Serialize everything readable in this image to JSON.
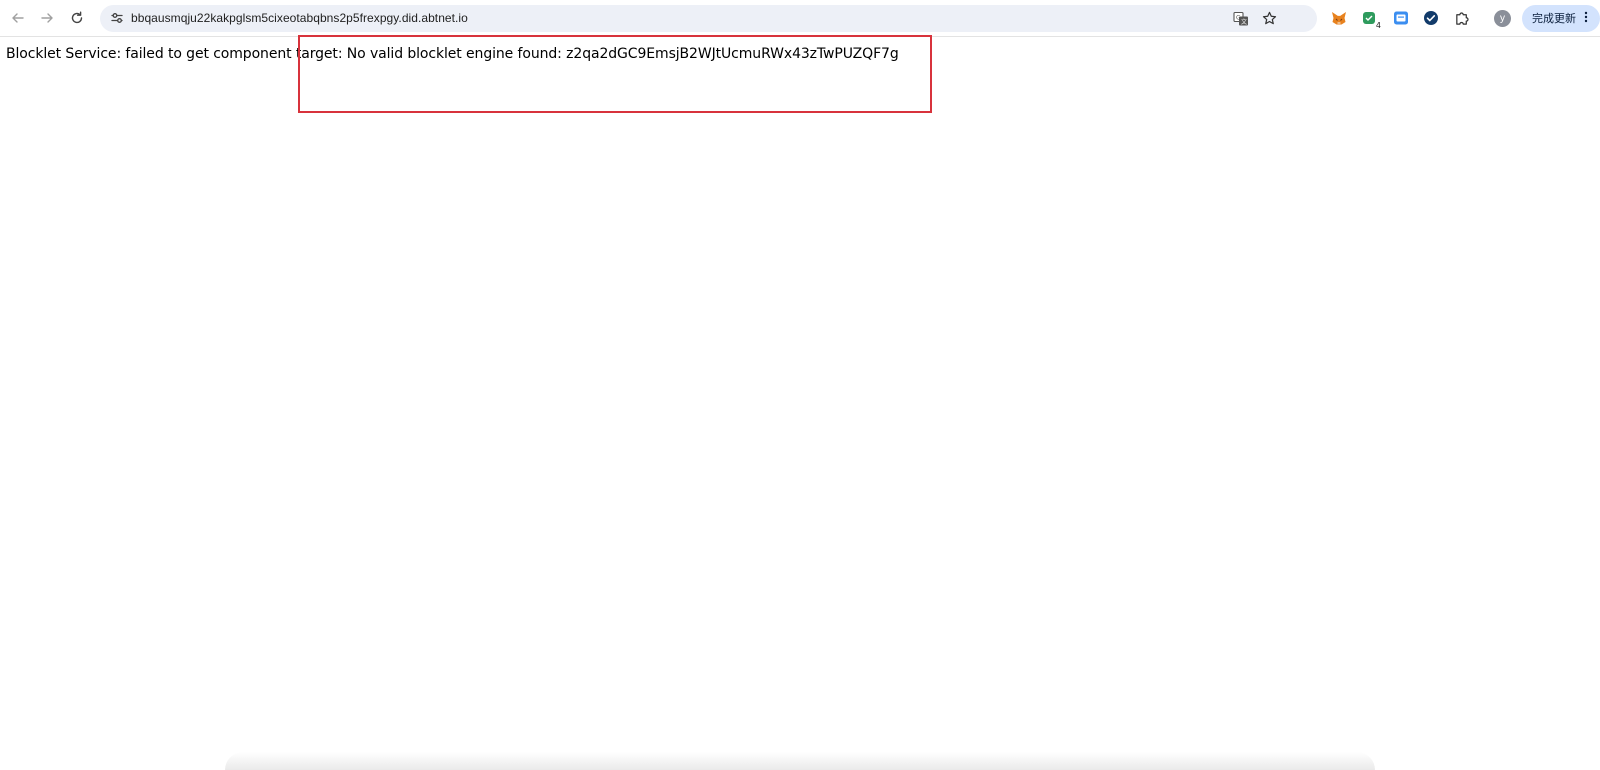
{
  "browser": {
    "url": "bbqausmqju22kakpglsm5cixeotabqbns2p5frexpgy.did.abtnet.io",
    "nav": {
      "back_icon": "arrow-left-icon",
      "forward_icon": "arrow-right-icon",
      "reload_icon": "reload-icon"
    },
    "omnibox_icons": [
      "site-info-icon",
      "translate-icon",
      "star-icon"
    ],
    "extensions": [
      {
        "name": "fox-extension-icon"
      },
      {
        "name": "green-extension-icon",
        "badge": "4"
      },
      {
        "name": "blue-square-extension-icon"
      },
      {
        "name": "check-circle-extension-icon"
      },
      {
        "name": "puzzle-icon"
      }
    ],
    "profile_initial": "y",
    "update_label": "完成更新",
    "update_icon": "more-vert-icon"
  },
  "page": {
    "message": "Blocklet Service: failed to get component target: No valid blocklet engine found: z2qa2dGC9EmsjB2WJtUcmuRWx43zTwPUZQF7g"
  },
  "colors": {
    "highlight_border": "#d8333c",
    "omnibox_bg": "#edf0f7",
    "update_bg": "#d3e3fd"
  }
}
